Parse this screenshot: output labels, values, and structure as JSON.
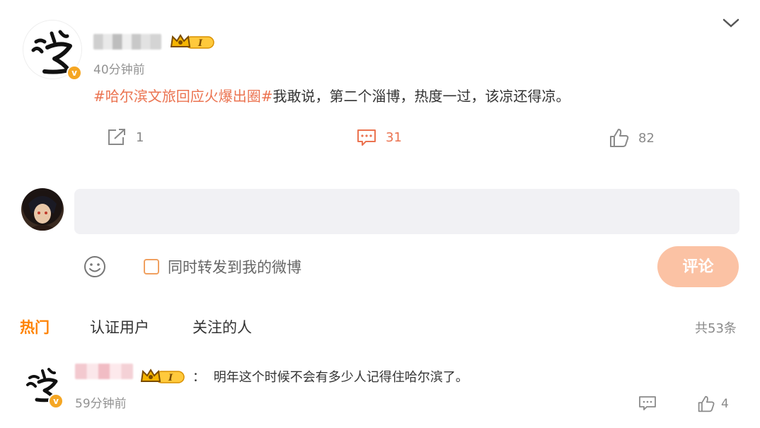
{
  "post": {
    "time": "40分钟前",
    "topic": "#哈尔滨文旅回应火爆出圈#",
    "text": "我敢说，第二个淄博，热度一过，该凉还得凉。",
    "badge_level": "I",
    "actions": {
      "repost_count": "1",
      "comment_count": "31",
      "like_count": "82"
    }
  },
  "composer": {
    "placeholder": "",
    "repost_label": "同时转发到我的微博",
    "submit_label": "评论"
  },
  "comments_section": {
    "tabs": [
      "热门",
      "认证用户",
      "关注的人"
    ],
    "active_tab": "热门",
    "total": "共53条"
  },
  "comments": [
    {
      "separator": "：",
      "text": "明年这个时候不会有多少人记得住哈尔滨了。",
      "time": "59分钟前",
      "badge_level": "I",
      "like_count": "4"
    }
  ],
  "colors": {
    "accent": "#ff8200",
    "topic": "#eb7350",
    "submit_disabled": "#fbc2a4",
    "verify": "#f5a623"
  },
  "icons": [
    "chevron-down-icon",
    "repost-icon",
    "comment-icon",
    "like-icon",
    "emoji-icon",
    "verified-icon",
    "crown-icon"
  ]
}
